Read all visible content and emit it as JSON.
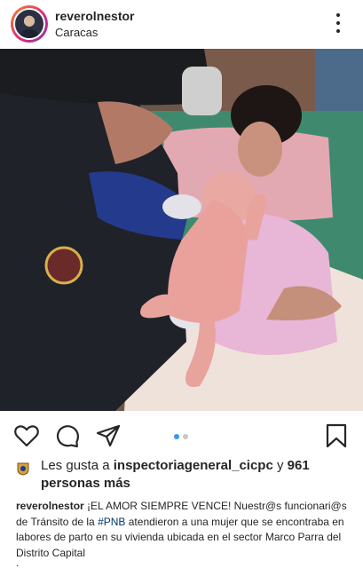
{
  "post": {
    "username": "reverolnestor",
    "location": "Caracas"
  },
  "photo": {
    "description_icon": "photo-image",
    "badge_colors": [
      "#6a2a2a",
      "#d6b14a"
    ],
    "skin": "#e9a8a2"
  },
  "carousel": {
    "count": 2,
    "active_index": 0
  },
  "icons": {
    "like": "heart-icon",
    "comment": "comment-icon",
    "share": "send-icon",
    "save": "bookmark-icon",
    "more": "more-icon"
  },
  "likes": {
    "prefix": "Les gusta a ",
    "user": "inspectoriageneral_cicpc",
    "middle": " y ",
    "count": "961",
    "suffix": "personas más"
  },
  "caption": {
    "user": "reverolnestor",
    "text_before_tag": "¡EL AMOR SIEMPRE VENCE! Nuestr@s funcionari@s de Tránsito de la ",
    "hashtag": "#PNB",
    "text_after_tag": " atendieron a una mujer que se encontraba en labores de parto en su vivienda ubicada en el sector Marco Parra del Distrito Capital",
    "trailing": "."
  },
  "colors": {
    "text": "#262626",
    "hashtag": "#00376b",
    "active_dot": "#3897f0",
    "inactive_dot": "#c7c7c7"
  }
}
